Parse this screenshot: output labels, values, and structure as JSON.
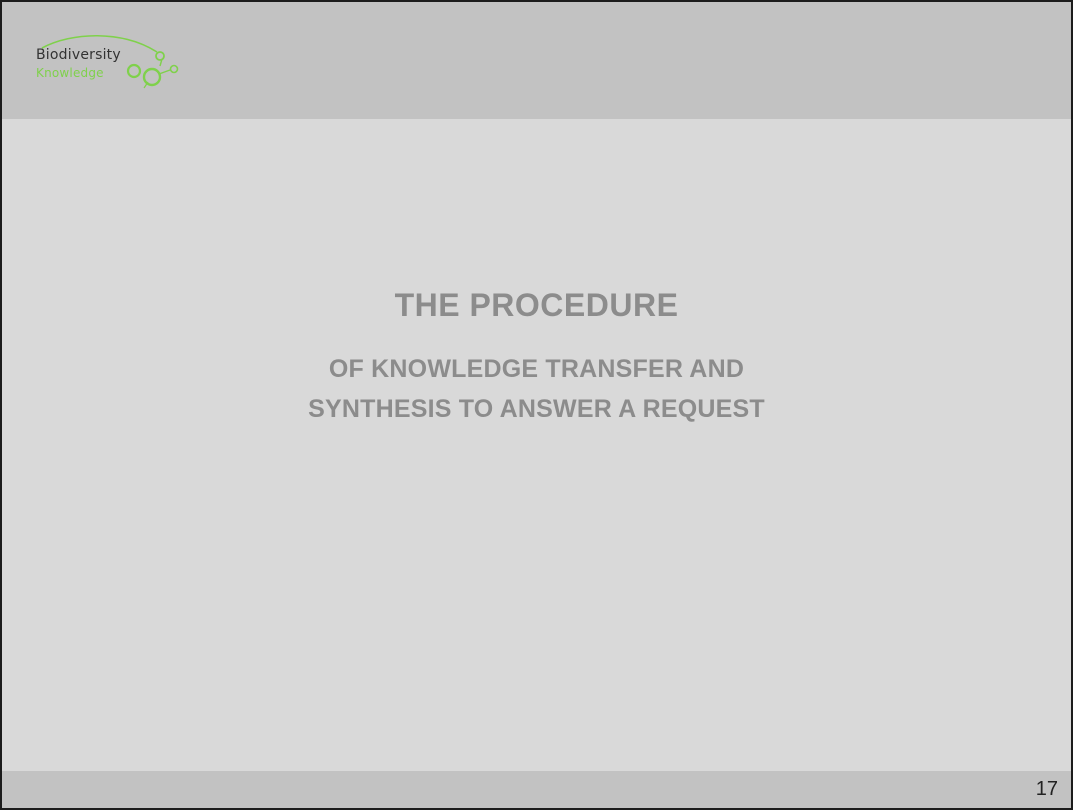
{
  "header": {
    "logo": {
      "line1": "Biodiversity",
      "line2": "Knowledge"
    }
  },
  "main": {
    "title": "THE PROCEDURE",
    "subtitle_lines": [
      "OF KNOWLEDGE TRANSFER AND",
      "SYNTHESIS TO ANSWER A REQUEST"
    ]
  },
  "footer": {
    "page_number": "17"
  },
  "colors": {
    "header_band": "#c2c2c2",
    "content_bg": "#d9d9d9",
    "title_text": "#8c8c8c",
    "logo_green": "#7fd14b",
    "border": "#1c1c1c"
  },
  "icons": {
    "logo_mark": "molecule-circles-icon"
  }
}
